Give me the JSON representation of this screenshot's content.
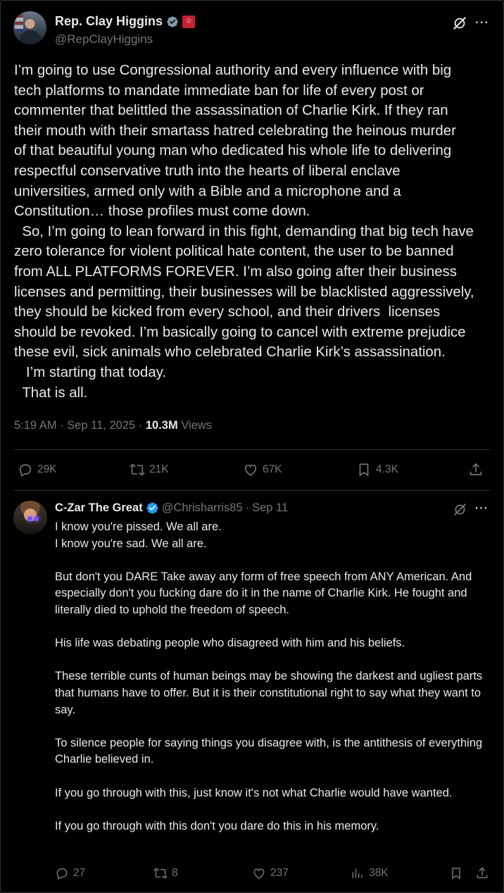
{
  "main_post": {
    "author_name": "Rep. Clay Higgins",
    "handle": "@RepClayHiggins",
    "text": "I’m going to use Congressional authority and every influence with big\ntech platforms to mandate immediate ban for life of every post or\ncommenter that belittled the assassination of Charlie Kirk. If they ran\ntheir mouth with their smartass hatred celebrating the heinous murder\nof that beautiful young man who dedicated his whole life to delivering\nrespectful conservative truth into the hearts of liberal enclave\nuniversities, armed only with a Bible and a microphone and a\nConstitution… those profiles must come down.\n  So, I’m going to lean forward in this fight, demanding that big tech have\nzero tolerance for violent political hate content, the user to be banned\nfrom ALL PLATFORMS FOREVER. I’m also going after their business\nlicenses and permitting, their businesses will be blacklisted aggressively,\nthey should be kicked from every school, and their drivers  licenses\nshould be revoked. I’m basically going to cancel with extreme prejudice\nthese evil, sick animals who celebrated Charlie Kirk’s assassination.\n   I’m starting that today.\n  That is all.",
    "time": "5:19 AM",
    "date": "Sep 11, 2025",
    "views_count": "10.3M",
    "views_label": "Views",
    "replies": "29K",
    "reposts": "21K",
    "likes": "67K",
    "bookmarks": "4.3K"
  },
  "reply": {
    "author_name": "C-Zar The Great",
    "handle": "@Chrisharris85",
    "date": "Sep 11",
    "paragraphs": [
      "I know you're pissed. We all are.",
      "I know you're sad. We all are.",
      "",
      "But don't you DARE Take away any form of free speech from ANY American. And especially don't you fucking dare do it in the name of Charlie Kirk. He fought and literally died to uphold the freedom of speech.",
      "",
      "His life was debating people who disagreed with him and his beliefs.",
      "",
      "These terrible cunts of human beings may be showing the darkest and ugliest parts that humans have to offer. But it is their constitutional right to say what they want to say.",
      "",
      "To silence people for saying things you disagree with, is the antithesis of everything Charlie believed in.",
      "",
      "If you go through with this, just know it's not what Charlie would have wanted.",
      "",
      "If you go through with this don't you dare do this in his memory."
    ],
    "replies": "27",
    "reposts": "8",
    "likes": "237",
    "views": "38K"
  },
  "colors": {
    "background": "#000000",
    "text": "#e7e9ea",
    "muted": "#71767b",
    "divider": "#2f3336",
    "verified_blue": "#1d9bf0",
    "verified_gray": "#829aab",
    "gov_badge": "#c51f2e"
  },
  "icons": [
    "grok-icon",
    "more-icon",
    "reply-icon",
    "repost-icon",
    "like-icon",
    "bookmark-icon",
    "share-icon",
    "views-icon",
    "verified-badge-icon"
  ]
}
